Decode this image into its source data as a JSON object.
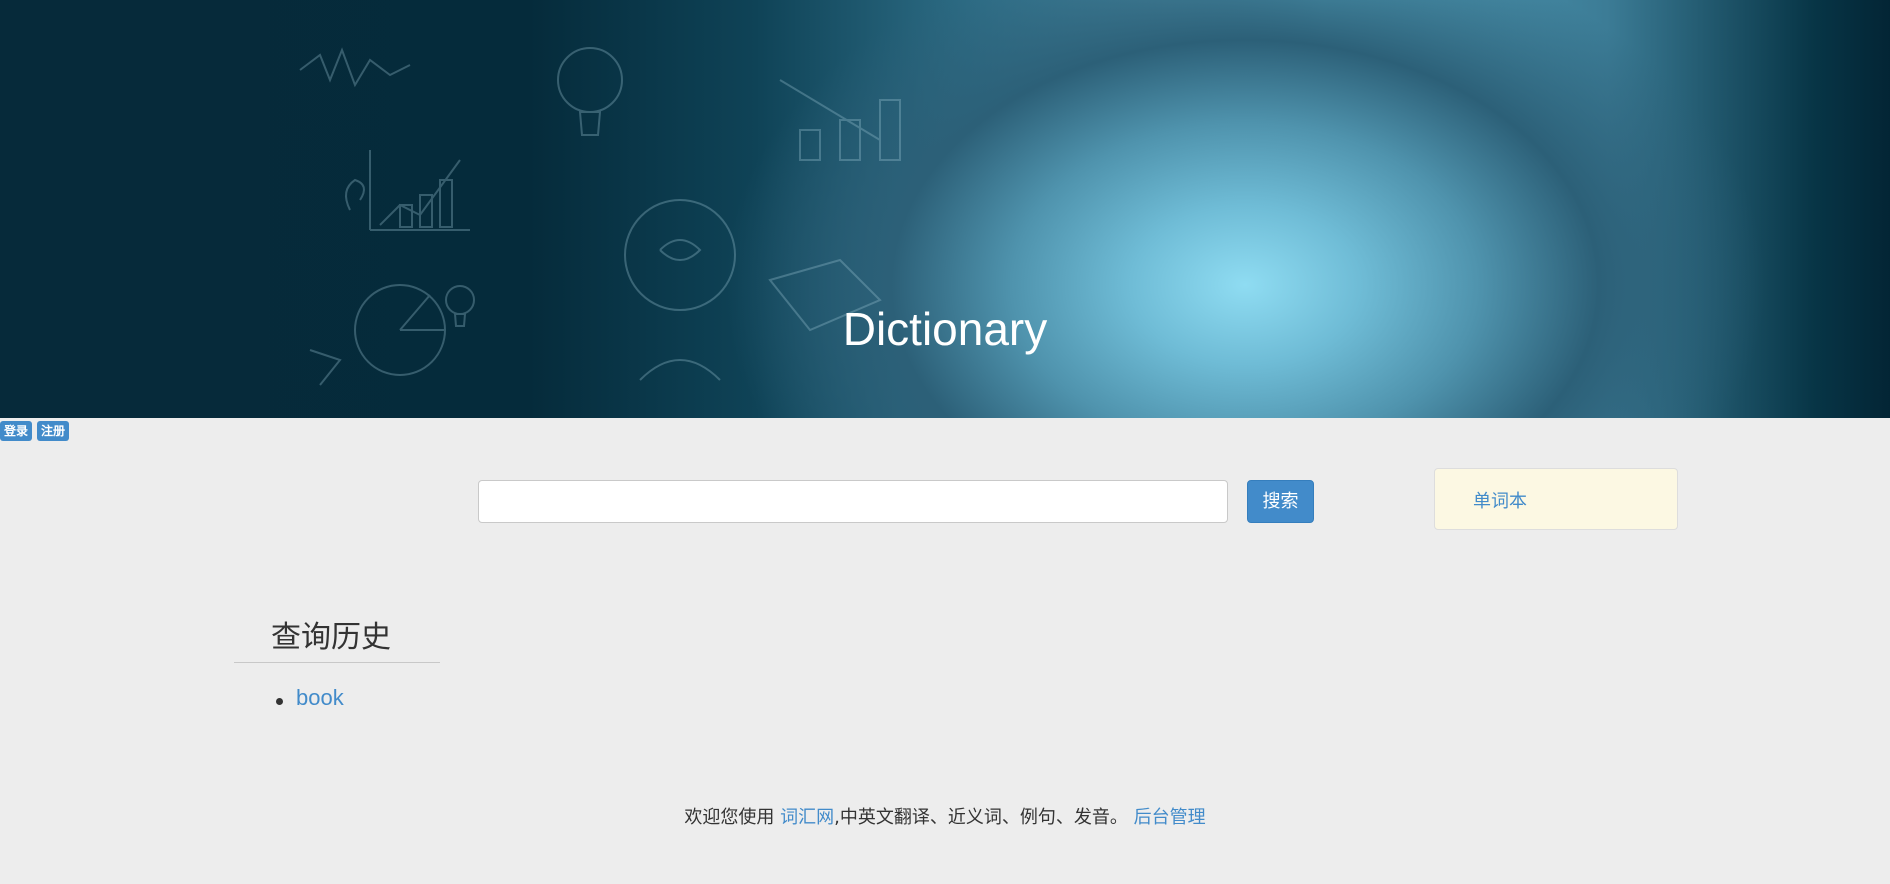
{
  "hero": {
    "title": "Dictionary"
  },
  "auth": {
    "login_label": "登录",
    "register_label": "注册"
  },
  "search": {
    "value": "",
    "placeholder": "",
    "button_label": "搜索"
  },
  "wordbook": {
    "label": "单词本"
  },
  "history": {
    "title": "查询历史",
    "items": [
      "book"
    ]
  },
  "footer": {
    "prefix": "欢迎您使用 ",
    "site_link": "词汇网",
    "middle": ",中英文翻译、近义词、例句、发音。 ",
    "admin_link": "后台管理"
  },
  "colors": {
    "accent": "#428bca",
    "background": "#ededed",
    "wordbook_bg": "#fcf8e3"
  }
}
